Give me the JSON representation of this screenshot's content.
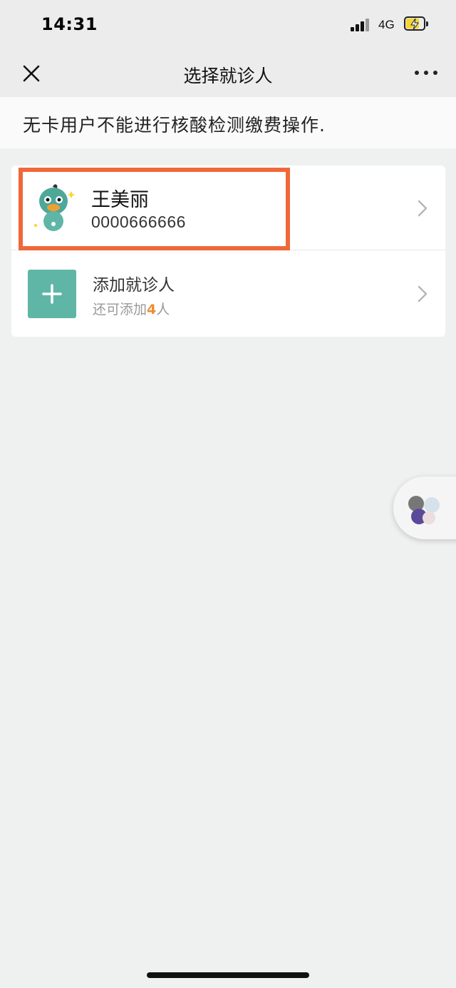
{
  "status_bar": {
    "time": "14:31",
    "network": "4G",
    "battery_level": 0.8
  },
  "nav": {
    "title": "选择就诊人",
    "close_icon": "close-icon",
    "more_icon": "more-icon"
  },
  "notice": {
    "text": "无卡用户不能进行核酸检测缴费操作."
  },
  "patients": [
    {
      "name": "王美丽",
      "id_number": "0000666666",
      "avatar_icon": "duck-mascot-icon",
      "highlighted": true
    }
  ],
  "add_patient": {
    "label": "添加就诊人",
    "remaining_prefix": "还可添加",
    "remaining_count": "4",
    "remaining_suffix": "人"
  },
  "colors": {
    "background": "#eff1f1",
    "accent_teal": "#5fb6a6",
    "highlight_orange": "#f0683a",
    "count_orange": "#f08c30"
  }
}
